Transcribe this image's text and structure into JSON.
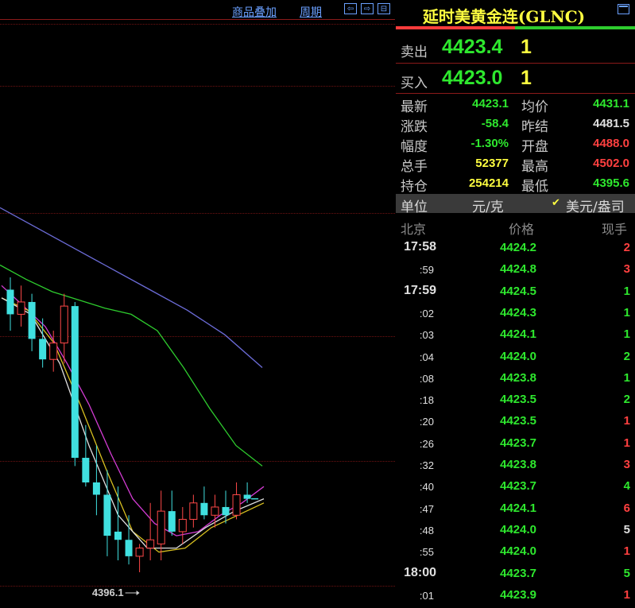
{
  "toolbar": {
    "overlay_label": "商品叠加",
    "period_label": "周期"
  },
  "chart": {
    "low_label": "4396.1",
    "chart_data": {
      "type": "candlestick",
      "candles": [
        {
          "o": 4465.0,
          "h": 4468.0,
          "l": 4455.0,
          "c": 4459.0
        },
        {
          "o": 4459.0,
          "h": 4466.0,
          "l": 4456.0,
          "c": 4462.0
        },
        {
          "o": 4462.0,
          "h": 4464.0,
          "l": 4450.0,
          "c": 4453.0
        },
        {
          "o": 4453.0,
          "h": 4458.0,
          "l": 4446.0,
          "c": 4448.0
        },
        {
          "o": 4448.0,
          "h": 4455.0,
          "l": 4445.0,
          "c": 4452.0
        },
        {
          "o": 4452.0,
          "h": 4464.0,
          "l": 4447.0,
          "c": 4461.0
        },
        {
          "o": 4461.0,
          "h": 4462.0,
          "l": 4422.0,
          "c": 4424.0
        },
        {
          "o": 4424.0,
          "h": 4432.0,
          "l": 4417.0,
          "c": 4418.0
        },
        {
          "o": 4418.0,
          "h": 4427.0,
          "l": 4410.0,
          "c": 4415.0
        },
        {
          "o": 4415.0,
          "h": 4421.0,
          "l": 4400.0,
          "c": 4405.0
        },
        {
          "o": 4406.0,
          "h": 4417.0,
          "l": 4399.0,
          "c": 4404.0
        },
        {
          "o": 4404.0,
          "h": 4410.0,
          "l": 4398.0,
          "c": 4400.0
        },
        {
          "o": 4400.0,
          "h": 4403.0,
          "l": 4396.1,
          "c": 4402.0
        },
        {
          "o": 4402.0,
          "h": 4413.0,
          "l": 4399.0,
          "c": 4404.0
        },
        {
          "o": 4403.0,
          "h": 4416.0,
          "l": 4399.0,
          "c": 4411.0
        },
        {
          "o": 4411.0,
          "h": 4416.0,
          "l": 4405.0,
          "c": 4406.0
        },
        {
          "o": 4406.0,
          "h": 4412.0,
          "l": 4403.0,
          "c": 4409.0
        },
        {
          "o": 4409.0,
          "h": 4415.0,
          "l": 4407.0,
          "c": 4413.0
        },
        {
          "o": 4413.0,
          "h": 4417.0,
          "l": 4409.0,
          "c": 4410.0
        },
        {
          "o": 4410.0,
          "h": 4415.0,
          "l": 4407.0,
          "c": 4412.0
        },
        {
          "o": 4412.0,
          "h": 4416.0,
          "l": 4408.0,
          "c": 4410.0
        },
        {
          "o": 4410.0,
          "h": 4418.0,
          "l": 4409.0,
          "c": 4415.0
        },
        {
          "o": 4415.0,
          "h": 4418.0,
          "l": 4413.0,
          "c": 4414.0
        }
      ],
      "moving_averages": [
        {
          "color": "#6c6cd8",
          "values": [
            4485.0,
            4480.0,
            4475.0,
            4470.0,
            4465.0,
            4460.0,
            4454.0,
            4446.0
          ]
        },
        {
          "color": "#2ecc2e",
          "values": [
            4471.0,
            4467.5,
            4464.5,
            4462.5,
            4460.5,
            4459.0,
            4455.0,
            4446.0,
            4436.0,
            4427.0,
            4422.0
          ]
        },
        {
          "color": "#d43cd4",
          "values": [
            4466.0,
            4461.0,
            4456.0,
            4447.0,
            4437.0,
            4425.0,
            4414.0,
            4408.0,
            4405.0,
            4406.0,
            4410.0,
            4413.0,
            4417.0
          ]
        },
        {
          "color": "#d8c020",
          "values": [
            4463.0,
            4460.0,
            4452.0,
            4437.0,
            4421.0,
            4406.0,
            4401.0,
            4402.0,
            4407.0,
            4410.0,
            4413.0
          ]
        },
        {
          "color": "#e0e0e0",
          "values": [
            4463.0,
            4459.0,
            4447.0,
            4427.0,
            4410.0,
            4402.0,
            4402.0,
            4407.0,
            4411.0,
            4414.0
          ]
        }
      ]
    }
  },
  "quote": {
    "title": "延时美黄金连(GLNC)",
    "sell_label": "卖出",
    "sell_price": "4423.4",
    "sell_vol": "1",
    "buy_label": "买入",
    "buy_price": "4423.0",
    "buy_vol": "1",
    "stats": [
      {
        "l1": "最新",
        "v1": "4423.1",
        "c1": "#2ee82e",
        "l2": "均价",
        "v2": "4431.1",
        "c2": "#2ee82e"
      },
      {
        "l1": "涨跌",
        "v1": "-58.4",
        "c1": "#2ee82e",
        "l2": "昨结",
        "v2": "4481.5",
        "c2": "#e0e0e0"
      },
      {
        "l1": "幅度",
        "v1": "-1.30%",
        "c1": "#2ee82e",
        "l2": "开盘",
        "v2": "4488.0",
        "c2": "#ff4040"
      },
      {
        "l1": "总手",
        "v1": "52377",
        "c1": "#ffff40",
        "l2": "最高",
        "v2": "4502.0",
        "c2": "#ff4040"
      },
      {
        "l1": "持仓",
        "v1": "254214",
        "c1": "#ffff40",
        "l2": "最低",
        "v2": "4395.6",
        "c2": "#2ee82e"
      }
    ],
    "unit_label": "单位",
    "unit_option1": "元/克",
    "unit_check": "✔",
    "unit_option2": "美元/盎司",
    "col_time": "北京",
    "col_price": "价格",
    "col_vol": "现手",
    "ticks": [
      {
        "t": "17:58",
        "p": "4424.2",
        "v": "2",
        "vc": "#ff4040",
        "major": true
      },
      {
        "t": ":59",
        "p": "4424.8",
        "v": "3",
        "vc": "#ff4040",
        "major": false
      },
      {
        "t": "17:59",
        "p": "4424.5",
        "v": "1",
        "vc": "#2ee82e",
        "major": true
      },
      {
        "t": ":02",
        "p": "4424.3",
        "v": "1",
        "vc": "#2ee82e",
        "major": false
      },
      {
        "t": ":03",
        "p": "4424.1",
        "v": "1",
        "vc": "#2ee82e",
        "major": false
      },
      {
        "t": ":04",
        "p": "4424.0",
        "v": "2",
        "vc": "#2ee82e",
        "major": false
      },
      {
        "t": ":08",
        "p": "4423.8",
        "v": "1",
        "vc": "#2ee82e",
        "major": false
      },
      {
        "t": ":18",
        "p": "4423.5",
        "v": "2",
        "vc": "#2ee82e",
        "major": false
      },
      {
        "t": ":20",
        "p": "4423.5",
        "v": "1",
        "vc": "#ff4040",
        "major": false
      },
      {
        "t": ":26",
        "p": "4423.7",
        "v": "1",
        "vc": "#ff4040",
        "major": false
      },
      {
        "t": ":32",
        "p": "4423.8",
        "v": "3",
        "vc": "#ff4040",
        "major": false
      },
      {
        "t": ":40",
        "p": "4423.7",
        "v": "4",
        "vc": "#2ee82e",
        "major": false
      },
      {
        "t": ":47",
        "p": "4424.1",
        "v": "6",
        "vc": "#ff4040",
        "major": false
      },
      {
        "t": ":48",
        "p": "4424.0",
        "v": "5",
        "vc": "#e0e0e0",
        "major": false
      },
      {
        "t": ":55",
        "p": "4424.0",
        "v": "1",
        "vc": "#ff4040",
        "major": false
      },
      {
        "t": "18:00",
        "p": "4423.7",
        "v": "5",
        "vc": "#2ee82e",
        "major": true
      },
      {
        "t": ":01",
        "p": "4423.9",
        "v": "1",
        "vc": "#ff4040",
        "major": false
      }
    ]
  }
}
